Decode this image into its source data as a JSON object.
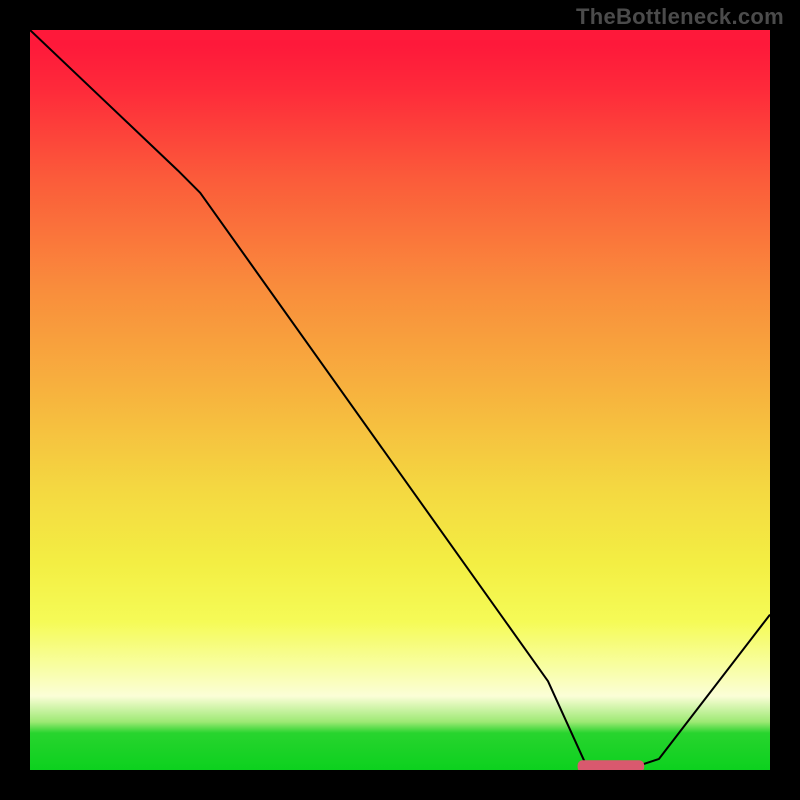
{
  "watermark": "TheBottleneck.com",
  "chart_data": {
    "type": "line",
    "title": "",
    "xlabel": "",
    "ylabel": "",
    "xlim": [
      0,
      100
    ],
    "ylim": [
      0,
      100
    ],
    "series": [
      {
        "name": "bottleneck-curve",
        "x": [
          0,
          10,
          20,
          23,
          70,
          75,
          82,
          85,
          100
        ],
        "y": [
          100,
          90.5,
          81,
          78,
          12,
          1,
          0.5,
          1.5,
          21
        ]
      }
    ],
    "marker": {
      "name": "optimal-range",
      "x_start": 74,
      "x_end": 83,
      "y": 0.5,
      "color": "#d9596e"
    },
    "gradient_stops": [
      {
        "pos": 0,
        "color": "#fe193a"
      },
      {
        "pos": 20,
        "color": "#fb5b3a"
      },
      {
        "pos": 48,
        "color": "#f7b03e"
      },
      {
        "pos": 72,
        "color": "#f3ee43"
      },
      {
        "pos": 90,
        "color": "#fbfed7"
      },
      {
        "pos": 95,
        "color": "#28d42e"
      },
      {
        "pos": 100,
        "color": "#0cd11e"
      }
    ]
  }
}
